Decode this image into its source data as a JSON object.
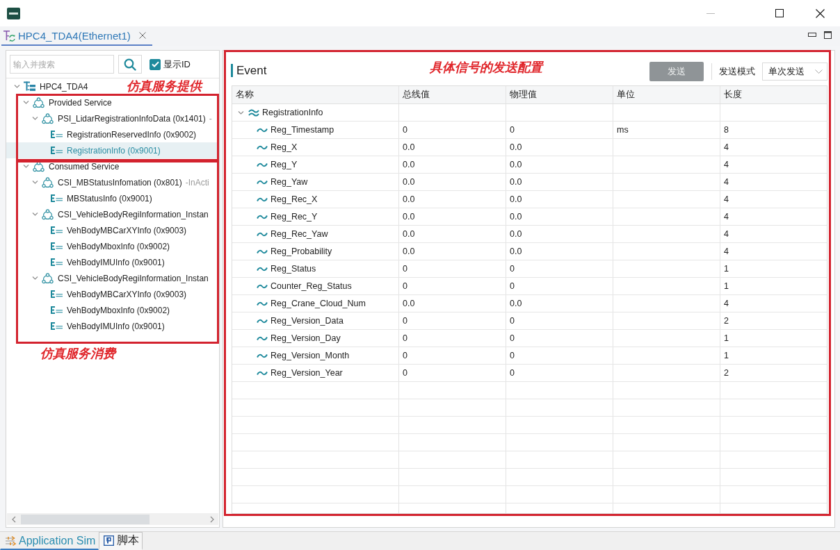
{
  "editor_tabs": [
    {
      "label": "HPC4_TDA4(Ethernet1)",
      "selected": true
    }
  ],
  "annotations": {
    "provided": "仿真服务提供",
    "consumed": "仿真服务消费",
    "event_config": "具体信号的发送配置"
  },
  "service_panel": {
    "search": {
      "placeholder": "输入并搜索"
    },
    "show_id": {
      "label": "显示ID",
      "checked": true
    },
    "tree": [
      {
        "kind": "root",
        "label": "HPC4_TDA4",
        "expanded": true,
        "selected": false,
        "children": [
          {
            "kind": "group",
            "label": "Provided Service",
            "expanded": true,
            "selected": false,
            "children": [
              {
                "kind": "service",
                "label": "PSI_LidarRegistrationInfoData (0x1401)",
                "status": "-",
                "expanded": true,
                "selected": false,
                "children": [
                  {
                    "kind": "event",
                    "label": "RegistrationReservedInfo (0x9002)",
                    "selected": false
                  },
                  {
                    "kind": "event",
                    "label": "RegistrationInfo (0x9001)",
                    "selected": true
                  }
                ]
              }
            ]
          },
          {
            "kind": "group",
            "label": "Consumed Service",
            "expanded": true,
            "selected": false,
            "children": [
              {
                "kind": "service",
                "label": "CSI_MBStatusInfomation (0x801)",
                "status": "-InActi",
                "expanded": true,
                "selected": false,
                "children": [
                  {
                    "kind": "event",
                    "label": "MBStatusInfo (0x9001)",
                    "selected": false
                  }
                ]
              },
              {
                "kind": "service",
                "label": "CSI_VehicleBodyRegiInformation_Instan",
                "expanded": true,
                "selected": false,
                "children": [
                  {
                    "kind": "event",
                    "label": "VehBodyMBCarXYInfo (0x9003)",
                    "selected": false
                  },
                  {
                    "kind": "event",
                    "label": "VehBodyMboxInfo (0x9002)",
                    "selected": false
                  },
                  {
                    "kind": "event",
                    "label": "VehBodyIMUInfo (0x9001)",
                    "selected": false
                  }
                ]
              },
              {
                "kind": "service",
                "label": "CSI_VehicleBodyRegiInformation_Instan",
                "expanded": true,
                "selected": false,
                "children": [
                  {
                    "kind": "event",
                    "label": "VehBodyMBCarXYInfo (0x9003)",
                    "selected": false
                  },
                  {
                    "kind": "event",
                    "label": "VehBodyMboxInfo (0x9002)",
                    "selected": false
                  },
                  {
                    "kind": "event",
                    "label": "VehBodyIMUInfo (0x9001)",
                    "selected": false
                  }
                ]
              }
            ]
          }
        ]
      }
    ]
  },
  "event_panel": {
    "title": "Event",
    "send_button": {
      "label": "发送",
      "disabled": true
    },
    "send_mode": {
      "label": "发送模式",
      "value": "单次发送"
    },
    "table": {
      "columns": [
        "名称",
        "总线值",
        "物理值",
        "单位",
        "长度"
      ],
      "rows": [
        {
          "kind": "group",
          "name": "RegistrationInfo",
          "expanded": true,
          "children": [
            {
              "kind": "signal",
              "name": "Reg_Timestamp",
              "bus_value": "0",
              "physical_value": "0",
              "unit": "ms",
              "length": "8"
            },
            {
              "kind": "signal",
              "name": "Reg_X",
              "bus_value": "0.0",
              "physical_value": "0.0",
              "length": "4"
            },
            {
              "kind": "signal",
              "name": "Reg_Y",
              "bus_value": "0.0",
              "physical_value": "0.0",
              "length": "4"
            },
            {
              "kind": "signal",
              "name": "Reg_Yaw",
              "bus_value": "0.0",
              "physical_value": "0.0",
              "length": "4"
            },
            {
              "kind": "signal",
              "name": "Reg_Rec_X",
              "bus_value": "0.0",
              "physical_value": "0.0",
              "length": "4"
            },
            {
              "kind": "signal",
              "name": "Reg_Rec_Y",
              "bus_value": "0.0",
              "physical_value": "0.0",
              "length": "4"
            },
            {
              "kind": "signal",
              "name": "Reg_Rec_Yaw",
              "bus_value": "0.0",
              "physical_value": "0.0",
              "length": "4"
            },
            {
              "kind": "signal",
              "name": "Reg_Probability",
              "bus_value": "0.0",
              "physical_value": "0.0",
              "length": "4"
            },
            {
              "kind": "signal",
              "name": "Reg_Status",
              "bus_value": "0",
              "physical_value": "0",
              "length": "1"
            },
            {
              "kind": "signal",
              "name": "Counter_Reg_Status",
              "bus_value": "0",
              "physical_value": "0",
              "length": "1"
            },
            {
              "kind": "signal",
              "name": "Reg_Crane_Cloud_Num",
              "bus_value": "0.0",
              "physical_value": "0.0",
              "length": "4"
            },
            {
              "kind": "signal",
              "name": "Reg_Version_Data",
              "bus_value": "0",
              "physical_value": "0",
              "length": "2"
            },
            {
              "kind": "signal",
              "name": "Reg_Version_Day",
              "bus_value": "0",
              "physical_value": "0",
              "length": "1"
            },
            {
              "kind": "signal",
              "name": "Reg_Version_Month",
              "bus_value": "0",
              "physical_value": "0",
              "length": "1"
            },
            {
              "kind": "signal",
              "name": "Reg_Version_Year",
              "bus_value": "0",
              "physical_value": "0",
              "length": "2"
            }
          ]
        }
      ]
    }
  },
  "bottom_tabs": [
    {
      "kind": "app",
      "label": "Application Sim",
      "selected": true
    },
    {
      "kind": "script",
      "label": "脚本",
      "selected": false
    }
  ]
}
